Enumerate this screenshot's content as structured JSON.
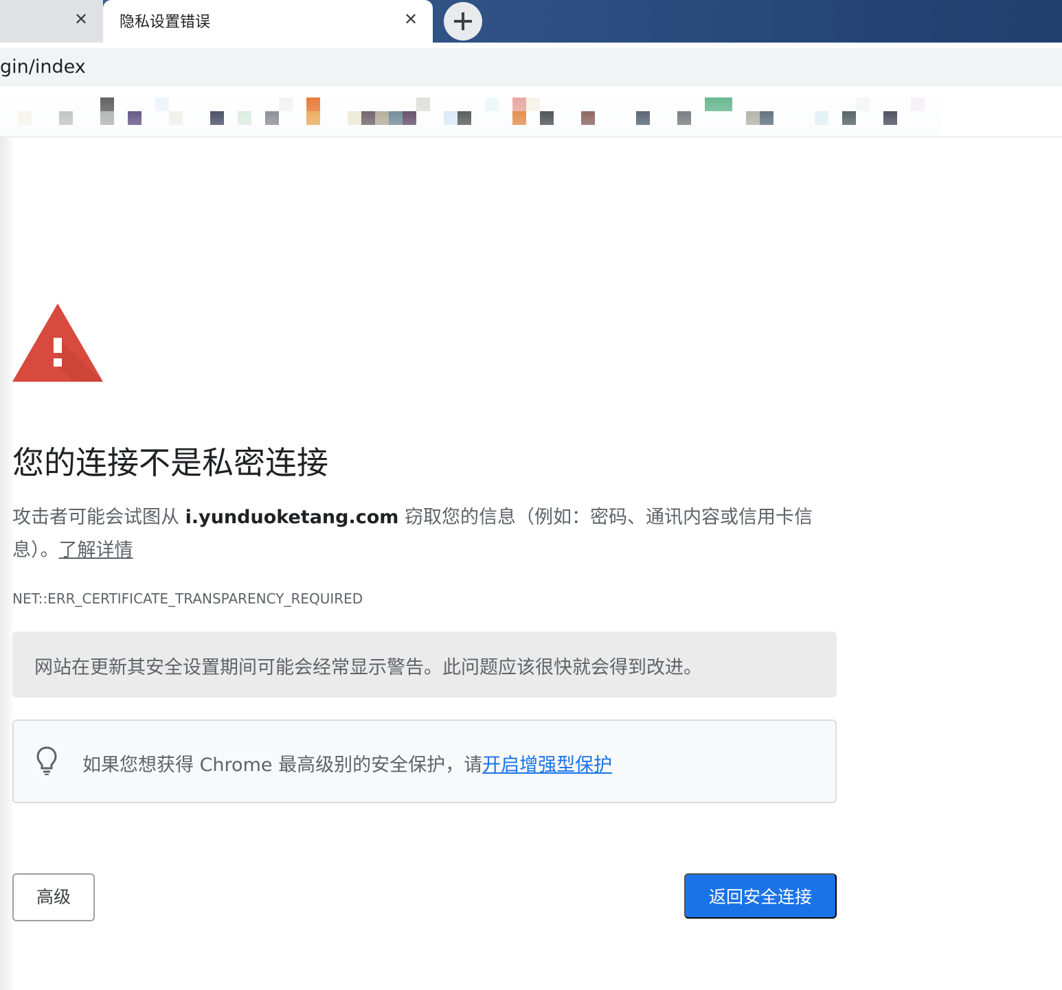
{
  "tabs": [
    {
      "title": "",
      "close_glyph": "✕",
      "active": false
    },
    {
      "title": "隐私设置错误",
      "close_glyph": "✕",
      "active": true
    }
  ],
  "new_tab_icon": "plus-icon",
  "address_bar": {
    "url": "gin/index"
  },
  "interstitial": {
    "heading": "您的连接不是私密连接",
    "body_prefix": "攻击者可能会试图从 ",
    "domain": "i.yunduoketang.com",
    "body_suffix": " 窃取您的信息（例如：密码、通讯内容或信用卡信息）。",
    "learn_more": "了解详情",
    "error_code": "NET::ERR_CERTIFICATE_TRANSPARENCY_REQUIRED",
    "notice": "网站在更新其安全设置期间可能会经常显示警告。此问题应该很快就会得到改进。",
    "tip_prefix": "如果您想获得 Chrome 最高级别的安全保护，请",
    "tip_link": "开启增强型保护",
    "advanced_button": "高级",
    "back_button": "返回安全连接"
  },
  "colors": {
    "warning_red": "#d84a3e",
    "primary_blue": "#1a73e8",
    "notice_bg": "#ebebeb"
  }
}
